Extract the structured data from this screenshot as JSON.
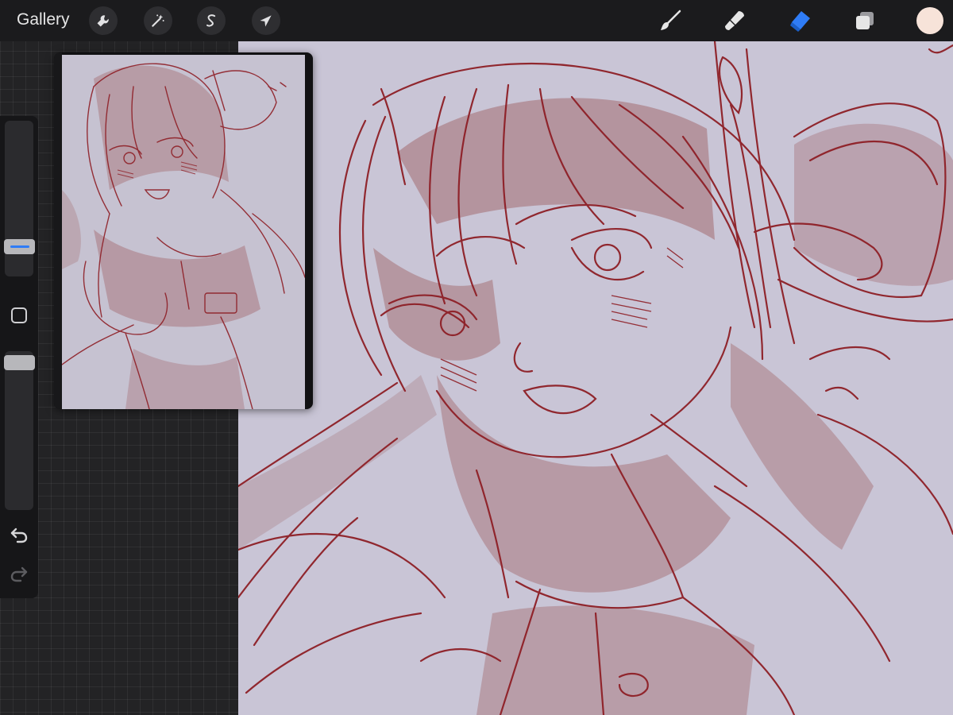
{
  "topbar": {
    "gallery_label": "Gallery",
    "tools_left": [
      {
        "name": "actions",
        "icon": "wrench-icon"
      },
      {
        "name": "adjustments",
        "icon": "magic-wand-icon"
      },
      {
        "name": "selection",
        "icon": "selection-s-icon"
      },
      {
        "name": "transform",
        "icon": "arrow-cursor-icon"
      }
    ],
    "tools_right": [
      {
        "name": "brush",
        "icon": "brush-icon"
      },
      {
        "name": "smudge",
        "icon": "smudge-icon"
      },
      {
        "name": "eraser",
        "icon": "eraser-icon",
        "active": true
      },
      {
        "name": "layers",
        "icon": "layers-icon"
      }
    ],
    "current_color": "#f7e3d9"
  },
  "sidebar": {
    "size_slider_icon": "slider-handle",
    "modify_button_icon": "square-icon",
    "undo_icon": "undo-icon",
    "redo_icon": "redo-icon"
  },
  "colors": {
    "accent": "#2f7cf6",
    "sketch_line": "#8e1f26",
    "canvas_paper": "#c9c5d6",
    "shadow_fill": "#b08b94"
  },
  "reference_window": {
    "icon": "reference-image"
  },
  "canvas": {
    "icon": "sketch-canvas"
  }
}
